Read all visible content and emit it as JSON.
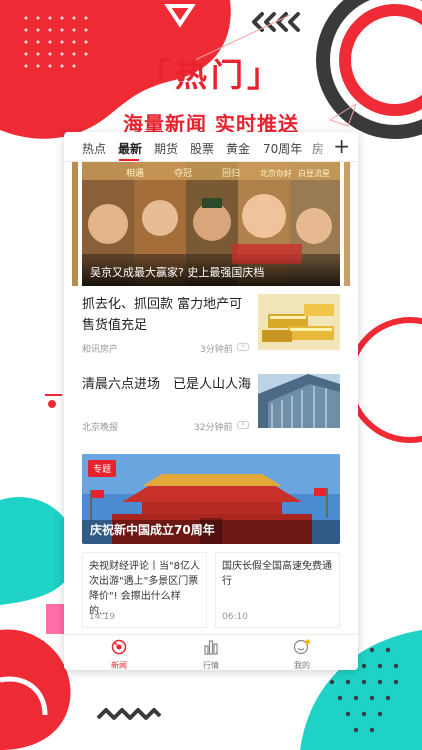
{
  "promo": {
    "title": "「热门」",
    "subtitle": "海量新闻 实时推送"
  },
  "tabs": [
    {
      "label": "热点"
    },
    {
      "label": "最新",
      "active": true
    },
    {
      "label": "期货"
    },
    {
      "label": "股票"
    },
    {
      "label": "黄金"
    },
    {
      "label": "70周年"
    },
    {
      "label": "房"
    }
  ],
  "tabs_more": "+",
  "banner": {
    "caption": "吴京又成最大赢家? 史上最强国庆档",
    "poster_text": [
      "相遇",
      "夺冠",
      "回归",
      "北京你好",
      "白昼流星"
    ]
  },
  "news": [
    {
      "title": "抓去化、抓回款 富力地产可售货值充足",
      "source": "和讯房产",
      "time": "3分钟前"
    },
    {
      "title": "清晨六点进场　已是人山人海",
      "source": "北京晚报",
      "time": "32分钟前"
    }
  ],
  "special": {
    "tag": "专题",
    "caption": "庆祝新中国成立70周年"
  },
  "mini_cards": [
    {
      "title": "央视财经评论丨当\"8亿人次出游\"遇上\"多景区门票降价\"! 会擦出什么样的...",
      "time": "14:19"
    },
    {
      "title": "国庆长假全国高速免费通行",
      "time": "06:10"
    }
  ],
  "bottom_nav": [
    {
      "label": "新闻",
      "active": true
    },
    {
      "label": "行情"
    },
    {
      "label": "我的"
    }
  ],
  "colors": {
    "accent": "#e8232f",
    "dark": "#3a3a3a",
    "teal": "#1fd2c6",
    "pink": "#ff6fa8"
  }
}
